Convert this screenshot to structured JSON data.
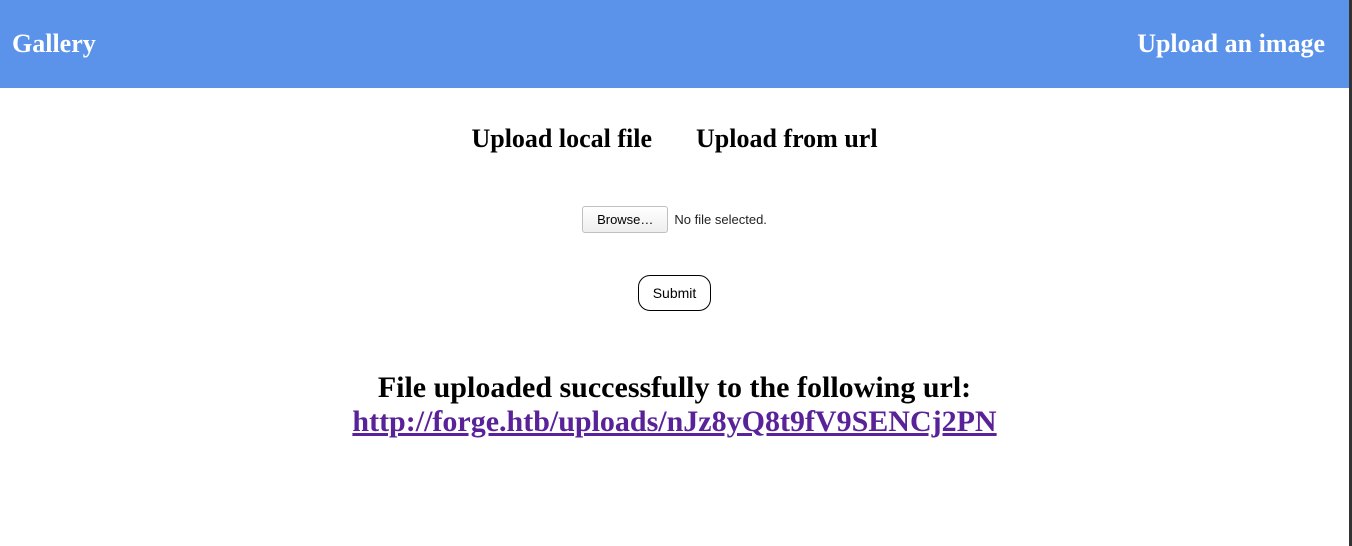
{
  "header": {
    "title": "Gallery",
    "action": "Upload an image"
  },
  "tabs": {
    "local": "Upload local file",
    "url": "Upload from url"
  },
  "file_input": {
    "browse_label": "Browse…",
    "status": "No file selected."
  },
  "submit": {
    "label": "Submit"
  },
  "result": {
    "message": "File uploaded successfully to the following url:",
    "url": "http://forge.htb/uploads/nJz8yQ8t9fV9SENCj2PN"
  }
}
